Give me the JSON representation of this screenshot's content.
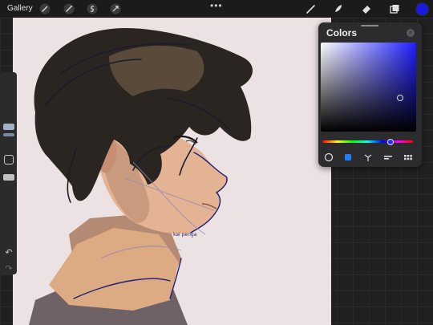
{
  "toolbar": {
    "gallery_label": "Gallery",
    "more_label": "•••",
    "tools": [
      "wrench",
      "magic-wand",
      "selection",
      "transform",
      "brush",
      "smudge",
      "eraser",
      "layers"
    ],
    "current_color": "#1a1adf"
  },
  "signature_text": "kai penga",
  "colors_panel": {
    "title": "Colors",
    "close_label": "×",
    "hue_color": "#1f1fff",
    "tabs": [
      "disc",
      "classic",
      "harmony",
      "value",
      "palettes"
    ],
    "active_tab": "classic"
  },
  "sidebar": {
    "undo_label": "↶",
    "redo_label": "↷"
  }
}
